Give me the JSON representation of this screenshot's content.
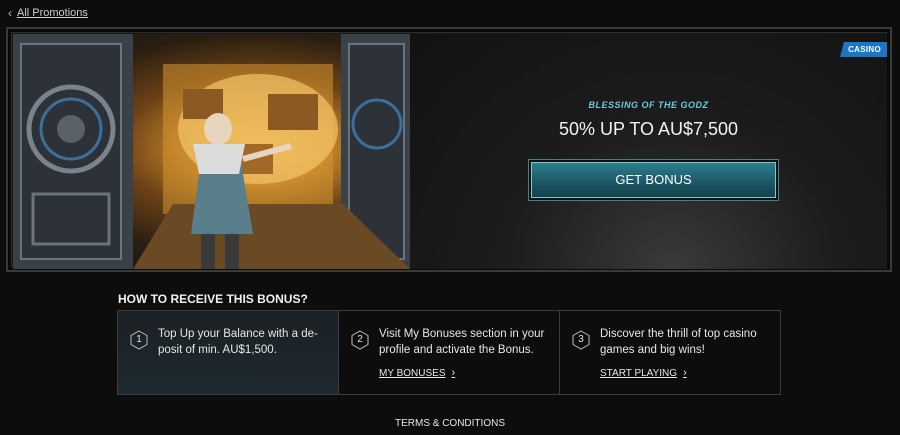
{
  "nav": {
    "back_label": "All Promotions"
  },
  "hero": {
    "badge": "CASINO",
    "promo_name": "BLESSING OF THE GODZ",
    "title": "50% UP TO AU$7,500",
    "cta_label": "GET BONUS",
    "art_icon": "vault-door-warrior-art"
  },
  "how": {
    "title": "HOW TO RECEIVE THIS BONUS?",
    "steps": [
      {
        "num": "1",
        "text": "Top Up your Balance with a de-posit of min. AU$1,500.",
        "link": ""
      },
      {
        "num": "2",
        "text": "Visit My Bonuses section in your profile and activate the Bonus.",
        "link": "MY BONUSES"
      },
      {
        "num": "3",
        "text": "Discover the thrill of top casino games and big wins!",
        "link": "START PLAYING"
      }
    ]
  },
  "footer": {
    "terms_label": "TERMS & CONDITIONS"
  },
  "colors": {
    "accent": "#2f7e8d",
    "badge": "#1b76c8",
    "promo_name": "#6ec8d8"
  }
}
